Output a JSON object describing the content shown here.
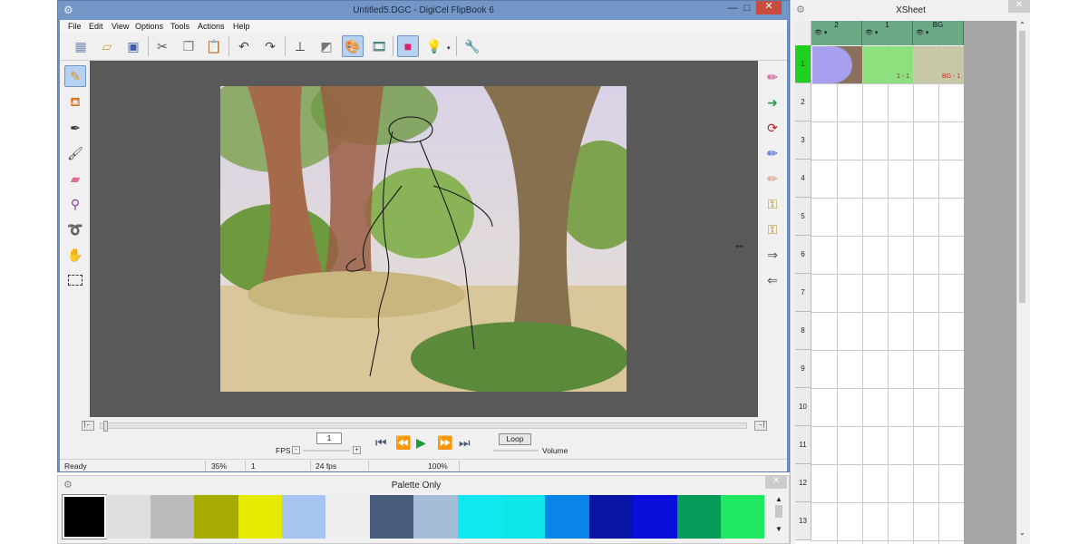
{
  "main_window": {
    "title": "Untitled5.DGC - DigiCel FlipBook 6",
    "minimize": "—",
    "maximize": "□",
    "close": "✕"
  },
  "menu": [
    "File",
    "Edit",
    "View",
    "Options",
    "Tools",
    "Actions",
    "Help"
  ],
  "toolbar": {
    "icons": [
      "new-scene-icon",
      "open-icon",
      "save-icon",
      "cut-icon",
      "copy-icon",
      "paste-icon",
      "undo-icon",
      "redo-icon",
      "stamp-icon",
      "eraser-icon",
      "paint-palette-icon",
      "film-icon",
      "color-card-icon",
      "lightbulb-icon",
      "wrench-icon"
    ],
    "active": [
      "paint-palette-icon",
      "color-card-icon"
    ]
  },
  "left_tools": {
    "icons": [
      "pencil-icon",
      "paint-bucket-icon",
      "ink-brush-icon",
      "brush-icon",
      "eraser-tool-icon",
      "dropper-icon",
      "lasso-icon",
      "hand-icon",
      "selection-rect-icon"
    ],
    "active": "pencil-icon"
  },
  "right_tools": {
    "icons": [
      "pencil-cap-icon",
      "pencil-arrow-icon",
      "paint-swap-icon",
      "ink-swap-icon",
      "eraser-swap-icon",
      "key-remove-icon",
      "key-add-icon",
      "key-arrow-right-icon",
      "key-arrow-left-icon"
    ]
  },
  "playback": {
    "start_btn": "|←",
    "end_btn": "→|",
    "fps_label": "FPS",
    "fps_value": "1",
    "minus": "-",
    "plus": "+",
    "loop_label": "Loop",
    "volume_label": "Volume"
  },
  "status": {
    "ready": "Ready",
    "zoom": "35%",
    "frame": "1",
    "fps": "24 fps",
    "percent": "100%"
  },
  "palette": {
    "title": "Palette Only",
    "close": "✕",
    "colors": [
      "#000000",
      "#dedede",
      "#bababa",
      "#a6ab00",
      "#e4eb00",
      "#a6c5f0",
      "#eeeeee",
      "#475c7c",
      "#a6bdd8",
      "#0fe8ee",
      "#0fe6ec",
      "#0b84ea",
      "#0a14a4",
      "#0a10dc",
      "#089c5a",
      "#20e860"
    ]
  },
  "xsheet": {
    "title": "XSheet",
    "close": "✕",
    "columns": [
      "2",
      "1",
      "BG"
    ],
    "cell_labels": [
      "1 - 1",
      "BG - 1"
    ],
    "rows": [
      "1",
      "2",
      "3",
      "4",
      "5",
      "6",
      "7",
      "8",
      "9",
      "10",
      "11",
      "12",
      "13"
    ]
  }
}
